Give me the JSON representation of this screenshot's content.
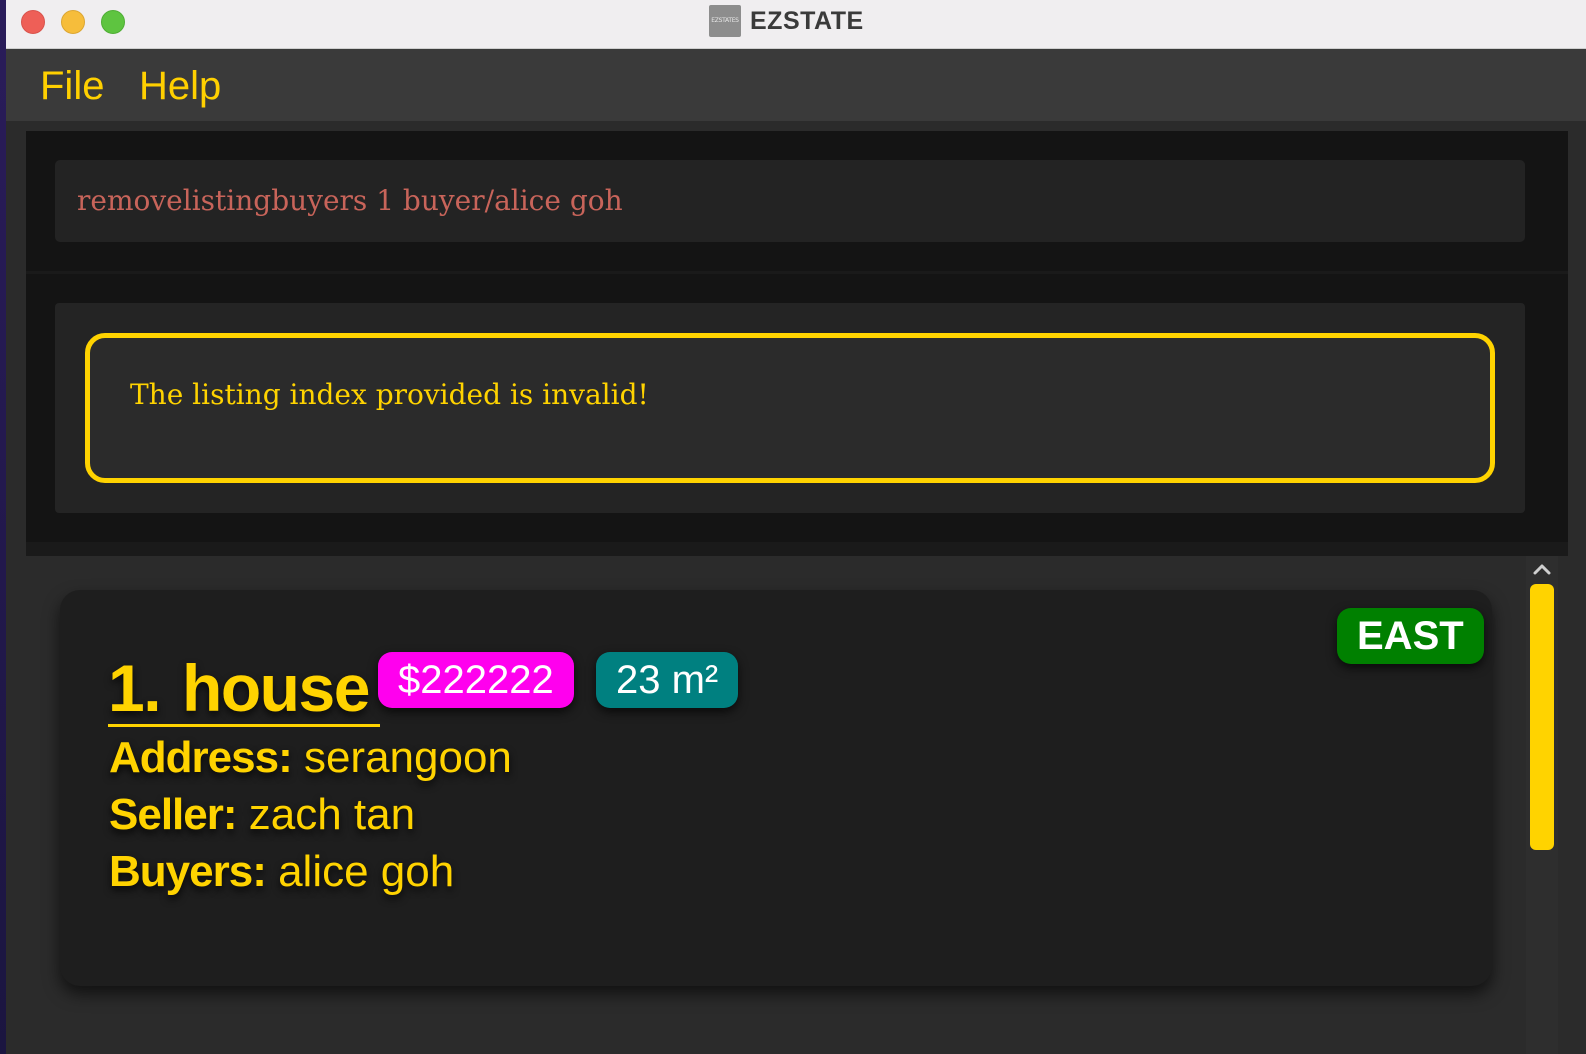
{
  "window": {
    "title": "EZSTATE",
    "icon_text": "EZSTATES"
  },
  "menu": {
    "file": "File",
    "help": "Help"
  },
  "command": {
    "value": "removelistingbuyers 1 buyer/alice goh"
  },
  "result": {
    "message": "The listing index provided is invalid!"
  },
  "listings": [
    {
      "index": "1.",
      "name": "house",
      "price": "$222222",
      "area": "23 m²",
      "region": "EAST",
      "address_label": "Address:",
      "address": "serangoon",
      "seller_label": "Seller:",
      "seller": "zach tan",
      "buyers_label": "Buyers:",
      "buyers": "alice goh"
    }
  ],
  "colors": {
    "accent": "#ffd300",
    "price_tag": "#ff00ee",
    "area_tag": "#008080",
    "region_tag": "#008000",
    "command_text": "#c8645a"
  },
  "icons": {
    "scroll_up": "chevron-up-icon"
  }
}
